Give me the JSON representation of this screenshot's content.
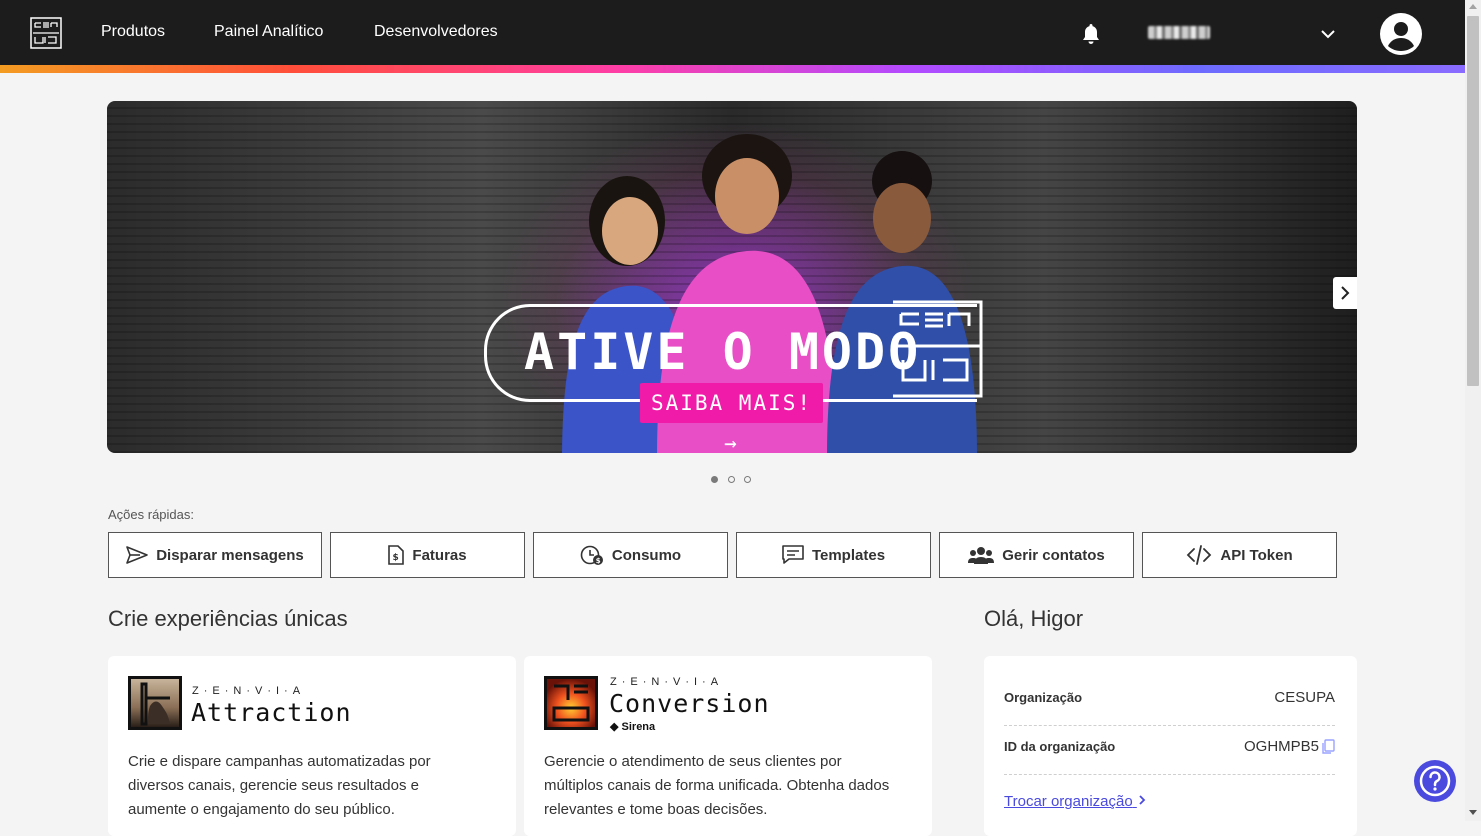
{
  "nav": {
    "items": [
      "Produtos",
      "Painel Analítico",
      "Desenvolvedores"
    ]
  },
  "banner": {
    "headline": "ATIVE O MODO",
    "cta_label": "SAIBA MAIS! →",
    "slides_total": 3,
    "active_slide": 1
  },
  "quick_actions": {
    "label": "Ações rápidas:",
    "buttons": [
      "Disparar mensagens",
      "Faturas",
      "Consumo",
      "Templates",
      "Gerir contatos",
      "API Token"
    ]
  },
  "experiences": {
    "title": "Crie experiências únicas",
    "cards": [
      {
        "brand": "Z·E·N·V·I·A",
        "product": "Attraction",
        "subtitle": "",
        "description": "Crie e dispare campanhas automatizadas por diversos canais, gerencie seus resultados e aumente o engajamento do seu público."
      },
      {
        "brand": "Z·E·N·V·I·A",
        "product": "Conversion",
        "subtitle": "◆ Sirena",
        "description": "Gerencie o atendimento de seus clientes por múltiplos canais de forma unificada. Obtenha dados relevantes e tome boas decisões."
      }
    ]
  },
  "account": {
    "greeting": "Olá, Higor",
    "org_label": "Organização",
    "org_value": "CESUPA",
    "id_label": "ID da organização",
    "id_value": "OGHMPB5",
    "switch_label": "Trocar organização"
  },
  "colors": {
    "topbar": "#1c1c1c",
    "cta": "#f01ba8",
    "link": "#4a4adf"
  }
}
